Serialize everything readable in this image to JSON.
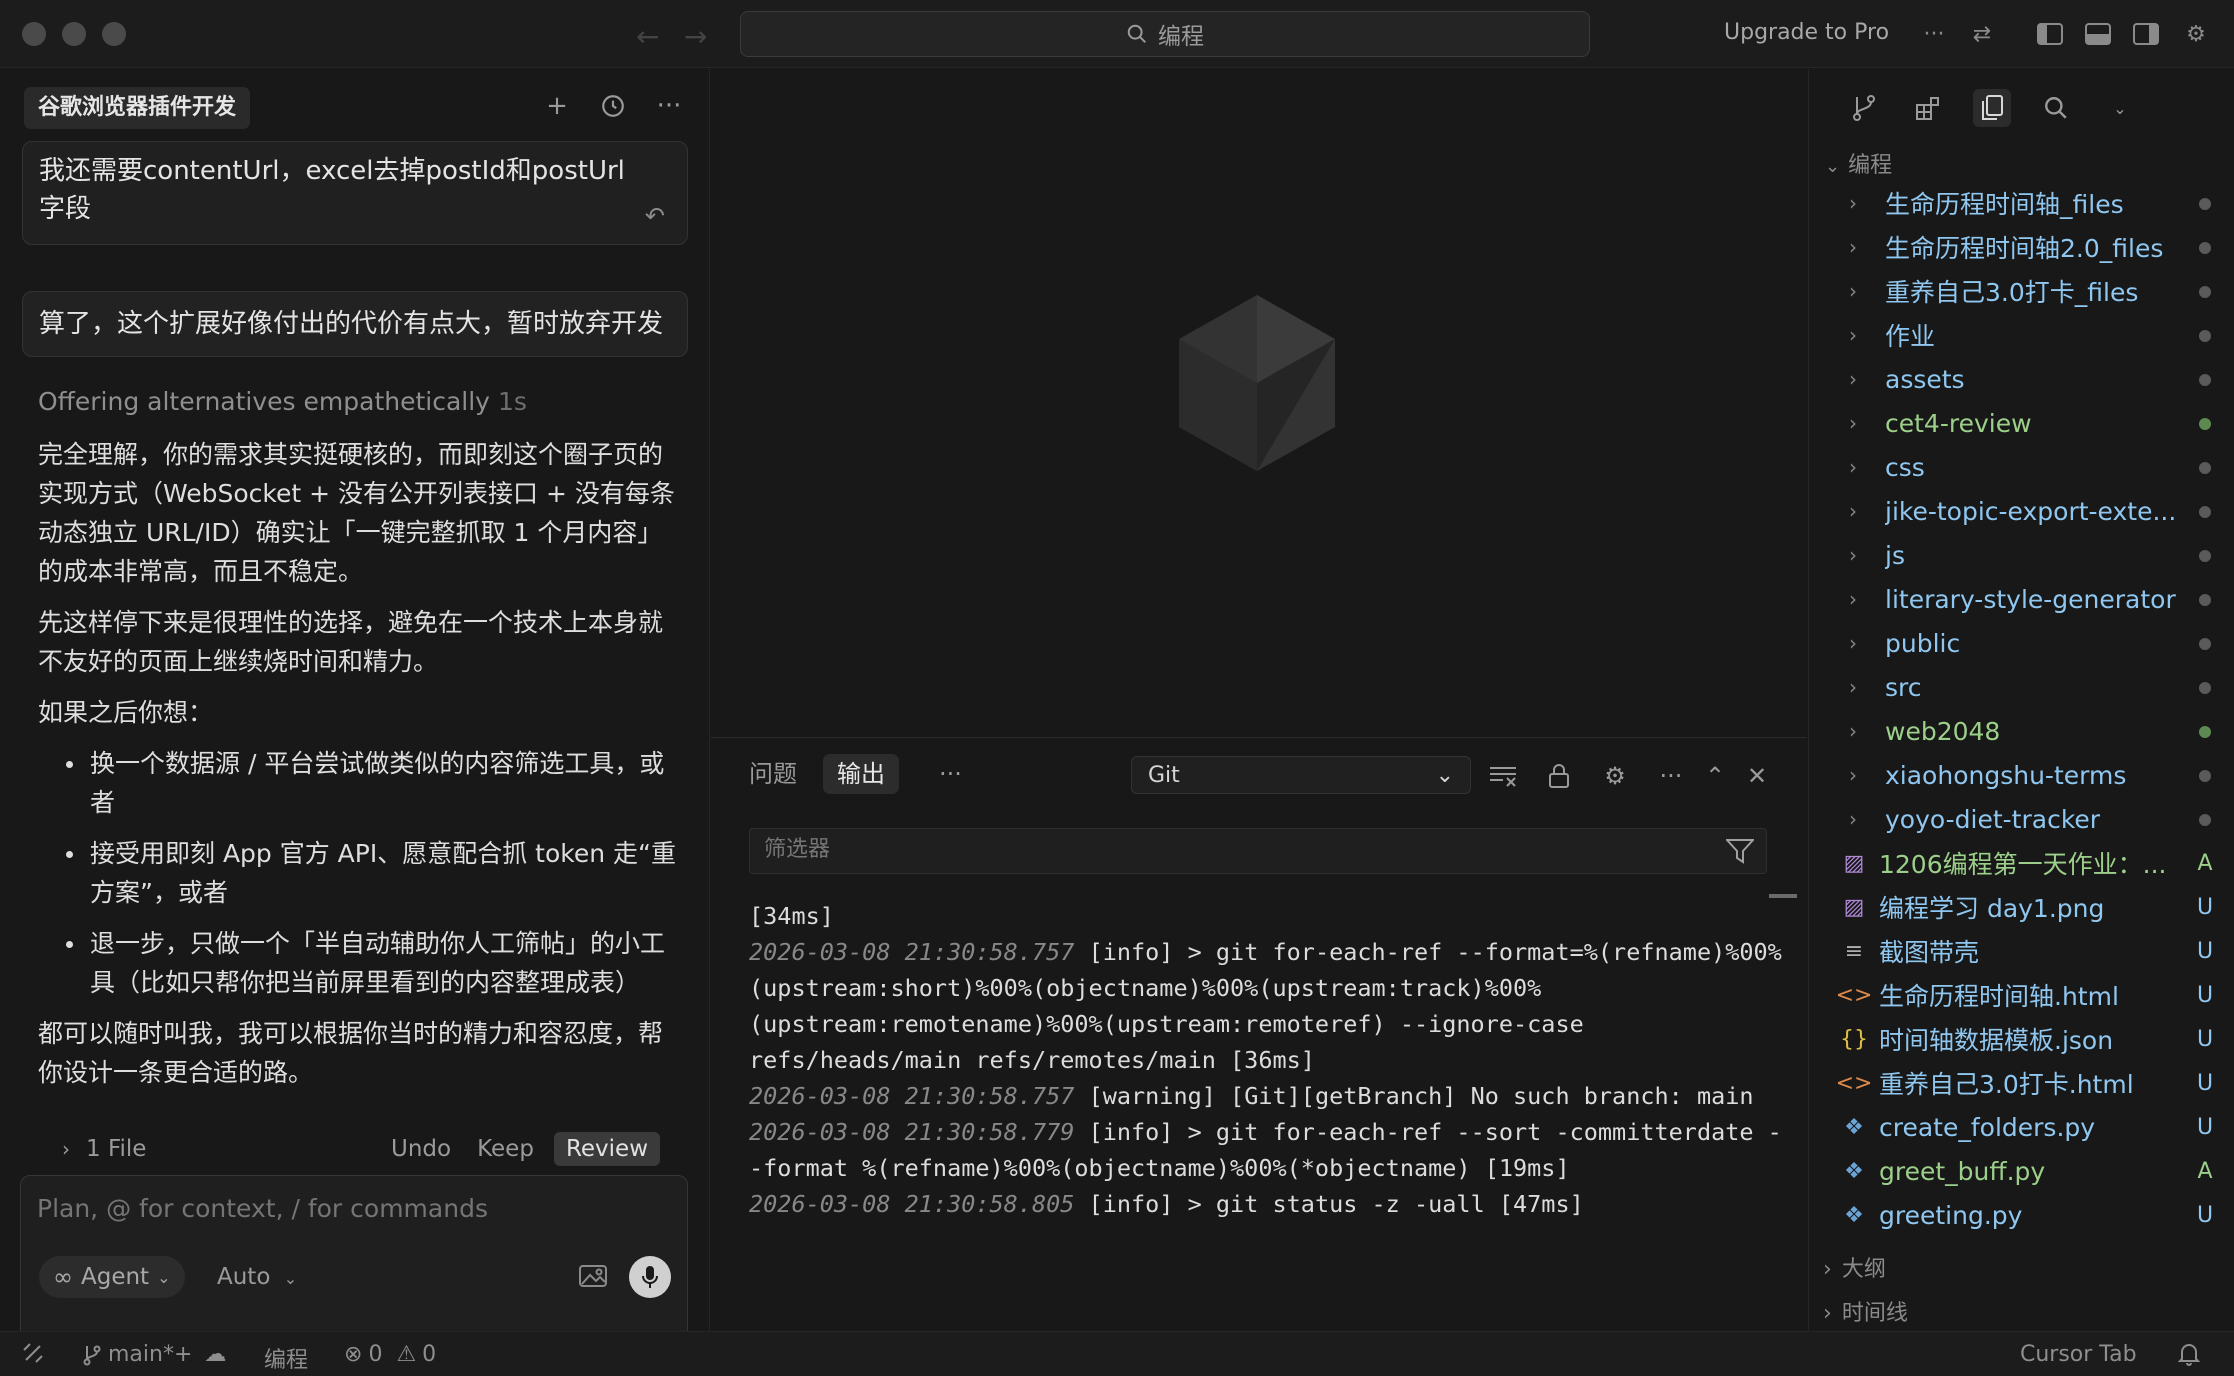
{
  "titlebar": {
    "search_label": "编程",
    "upgrade_label": "Upgrade to Pro"
  },
  "chat": {
    "title": "谷歌浏览器插件开发",
    "messages": {
      "user_1": "我还需要contentUrl，excel去掉postId和postUrl字段",
      "user_2": "算了，这个扩展好像付出的代价有点大，暂时放弃开发"
    },
    "thinking_label": "Offering alternatives empathetically",
    "thinking_time": "1s",
    "ai": {
      "p1": "完全理解，你的需求其实挺硬核的，而即刻这个圈子页的实现方式（WebSocket + 没有公开列表接口 + 没有每条动态独立 URL/ID）确实让「一键完整抓取 1 个月内容」的成本非常高，而且不稳定。",
      "p2": "先这样停下来是很理性的选择，避免在一个技术上本身就不友好的页面上继续烧时间和精力。",
      "p3": "如果之后你想：",
      "bullets": [
        "换一个数据源 / 平台尝试做类似的内容筛选工具，或者",
        "接受用即刻 App 官方 API、愿意配合抓 token 走“重方案”，或者",
        "退一步，只做一个「半自动辅助你人工筛帖」的小工具（比如只帮你把当前屏里看到的内容整理成表）"
      ],
      "p4": "都可以随时叫我，我可以根据你当时的精力和容忍度，帮你设计一条更合适的路。"
    },
    "file_bar": {
      "files_label": "1 File",
      "undo": "Undo",
      "keep": "Keep",
      "review": "Review"
    },
    "composer": {
      "placeholder": "Plan, @ for context, / for commands",
      "agent_label": "Agent",
      "model_label": "Auto"
    }
  },
  "panel": {
    "tabs": {
      "problems": "问题",
      "output": "输出",
      "more": "···"
    },
    "channel": "Git",
    "filter_placeholder": "筛选器",
    "log": [
      {
        "ts": "",
        "text": "[34ms]"
      },
      {
        "ts": "2026-03-08 21:30:58.757",
        "text": " [info] > git for-each-ref --format=%(refname)%00%(upstream:short)%00%(objectname)%00%(upstream:track)%00%(upstream:remotename)%00%(upstream:remoteref) --ignore-case refs/heads/main refs/remotes/main [36ms]"
      },
      {
        "ts": "2026-03-08 21:30:58.757",
        "text": " [warning] [Git][getBranch] No such branch: main"
      },
      {
        "ts": "2026-03-08 21:30:58.779",
        "text": " [info] > git for-each-ref --sort -committerdate --format %(refname)%00%(objectname)%00%(*objectname) [19ms]"
      },
      {
        "ts": "2026-03-08 21:30:58.805",
        "text": " [info] > git status -z -uall [47ms]"
      }
    ]
  },
  "explorer": {
    "root": "编程",
    "items": [
      {
        "name": "生命历程时间轴_files",
        "type": "folder",
        "color": "#8fc7f0",
        "status": "dot",
        "status_color": "#5a5a5a"
      },
      {
        "name": "生命历程时间轴2.0_files",
        "type": "folder",
        "color": "#8fc7f0",
        "status": "dot",
        "status_color": "#5a5a5a"
      },
      {
        "name": "重养自己3.0打卡_files",
        "type": "folder",
        "color": "#8fc7f0",
        "status": "dot",
        "status_color": "#5a5a5a"
      },
      {
        "name": "作业",
        "type": "folder",
        "color": "#8fc7f0",
        "status": "dot",
        "status_color": "#5a5a5a"
      },
      {
        "name": "assets",
        "type": "folder",
        "color": "#8fc7f0",
        "status": "dot",
        "status_color": "#5a5a5a"
      },
      {
        "name": "cet4-review",
        "type": "folder",
        "color": "#9ccf8a",
        "status": "dot",
        "status_color": "#5d8a52"
      },
      {
        "name": "css",
        "type": "folder",
        "color": "#8fc7f0",
        "status": "dot",
        "status_color": "#5a5a5a"
      },
      {
        "name": "jike-topic-export-exte...",
        "type": "folder",
        "color": "#8fc7f0",
        "status": "dot",
        "status_color": "#5a5a5a"
      },
      {
        "name": "js",
        "type": "folder",
        "color": "#8fc7f0",
        "status": "dot",
        "status_color": "#5a5a5a"
      },
      {
        "name": "literary-style-generator",
        "type": "folder",
        "color": "#8fc7f0",
        "status": "dot",
        "status_color": "#5a5a5a"
      },
      {
        "name": "public",
        "type": "folder",
        "color": "#8fc7f0",
        "status": "dot",
        "status_color": "#5a5a5a"
      },
      {
        "name": "src",
        "type": "folder",
        "color": "#8fc7f0",
        "status": "dot",
        "status_color": "#5a5a5a"
      },
      {
        "name": "web2048",
        "type": "folder",
        "color": "#9ccf8a",
        "status": "dot",
        "status_color": "#5d8a52"
      },
      {
        "name": "xiaohongshu-terms",
        "type": "folder",
        "color": "#8fc7f0",
        "status": "dot",
        "status_color": "#5a5a5a"
      },
      {
        "name": "yoyo-diet-tracker",
        "type": "folder",
        "color": "#8fc7f0",
        "status": "dot",
        "status_color": "#5a5a5a"
      },
      {
        "name": "1206编程第一天作业：...",
        "type": "image",
        "icon": "▨",
        "icon_color": "#b08ad8",
        "color": "#9ccf8a",
        "status": "A",
        "status_color": "#9ccf8a"
      },
      {
        "name": "编程学习 day1.png",
        "type": "image",
        "icon": "▨",
        "icon_color": "#b08ad8",
        "color": "#8fc7f0",
        "status": "U",
        "status_color": "#8fc7f0"
      },
      {
        "name": "截图带壳",
        "type": "file",
        "icon": "≡",
        "icon_color": "#b0b0b0",
        "color": "#8fc7f0",
        "status": "U",
        "status_color": "#8fc7f0"
      },
      {
        "name": "生命历程时间轴.html",
        "type": "file",
        "icon": "<>",
        "icon_color": "#e08a4a",
        "color": "#8fc7f0",
        "status": "U",
        "status_color": "#8fc7f0"
      },
      {
        "name": "时间轴数据模板.json",
        "type": "file",
        "icon": "{}",
        "icon_color": "#e0c040",
        "color": "#8fc7f0",
        "status": "U",
        "status_color": "#8fc7f0"
      },
      {
        "name": "重养自己3.0打卡.html",
        "type": "file",
        "icon": "<>",
        "icon_color": "#e08a4a",
        "color": "#8fc7f0",
        "status": "U",
        "status_color": "#8fc7f0"
      },
      {
        "name": "create_folders.py",
        "type": "file",
        "icon": "❖",
        "icon_color": "#6aa4d8",
        "color": "#8fc7f0",
        "status": "U",
        "status_color": "#8fc7f0"
      },
      {
        "name": "greet_buff.py",
        "type": "file",
        "icon": "❖",
        "icon_color": "#6aa4d8",
        "color": "#9ccf8a",
        "status": "A",
        "status_color": "#9ccf8a"
      },
      {
        "name": "greeting.py",
        "type": "file",
        "icon": "❖",
        "icon_color": "#6aa4d8",
        "color": "#8fc7f0",
        "status": "U",
        "status_color": "#8fc7f0"
      }
    ],
    "sections": {
      "outline": "大纲",
      "timeline": "时间线"
    }
  },
  "statusbar": {
    "branch": "main*+",
    "workspace": "编程",
    "errors": "0",
    "warnings": "0",
    "cursor_tab": "Cursor Tab"
  }
}
